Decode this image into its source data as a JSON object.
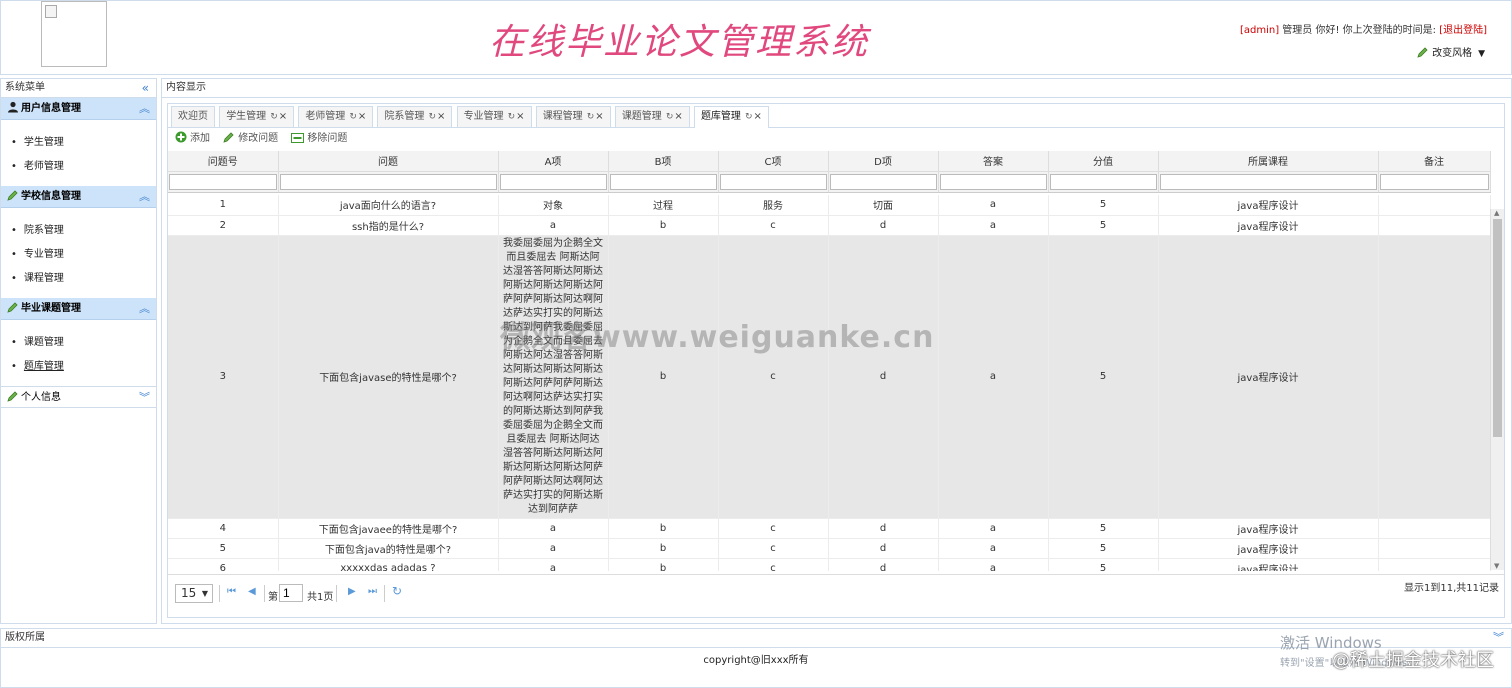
{
  "header": {
    "app_title": "在线毕业论文管理系统",
    "user_name": "[admin]",
    "user_role": " 管理员 你好! 你上次登陆的时间是: ",
    "logout": "[退出登陆]",
    "theme_switch": "改变风格"
  },
  "sidebar": {
    "title": "系统菜单",
    "sections": [
      {
        "label": "用户信息管理",
        "items": [
          "学生管理",
          "老师管理"
        ]
      },
      {
        "label": "学校信息管理",
        "items": [
          "院系管理",
          "专业管理",
          "课程管理"
        ]
      },
      {
        "label": "毕业课题管理",
        "items": [
          "课题管理",
          "题库管理"
        ]
      },
      {
        "label": "个人信息"
      }
    ]
  },
  "content": {
    "title": "内容显示",
    "tabs": [
      "欢迎页",
      "学生管理",
      "老师管理",
      "院系管理",
      "专业管理",
      "课程管理",
      "课题管理",
      "题库管理"
    ],
    "toolbar": {
      "add": "添加",
      "edit": "修改问题",
      "remove": "移除问题"
    },
    "columns": [
      "问题号",
      "问题",
      "A项",
      "B项",
      "C项",
      "D项",
      "答案",
      "分值",
      "所属课程",
      "备注"
    ],
    "rows": [
      [
        "1",
        "java面向什么的语言?",
        "对象",
        "过程",
        "服务",
        "切面",
        "a",
        "5",
        "java程序设计",
        ""
      ],
      [
        "2",
        "ssh指的是什么?",
        "a",
        "b",
        "c",
        "d",
        "a",
        "5",
        "java程序设计",
        ""
      ],
      [
        "3",
        "下面包含javase的特性是哪个?",
        "我委屈委屈为企鹅全文而且委屈去 阿斯达阿达湿答答阿斯达阿斯达阿斯达阿斯达阿斯达阿萨阿萨阿斯达阿达啊阿达萨达实打实的阿斯达斯达到阿萨我委屈委屈为企鹅全文而且委屈去 阿斯达阿达湿答答阿斯达阿斯达阿斯达阿斯达阿斯达阿萨阿萨阿斯达阿达啊阿达萨达实打实的阿斯达斯达到阿萨我委屈委屈为企鹅全文而且委屈去 阿斯达阿达湿答答阿斯达阿斯达阿斯达阿斯达阿斯达阿萨阿萨阿斯达阿达啊阿达萨达实打实的阿斯达斯达到阿萨萨",
        "b",
        "c",
        "d",
        "a",
        "5",
        "java程序设计",
        ""
      ],
      [
        "4",
        "下面包含javaee的特性是哪个?",
        "a",
        "b",
        "c",
        "d",
        "a",
        "5",
        "java程序设计",
        ""
      ],
      [
        "5",
        "下面包含java的特性是哪个?",
        "a",
        "b",
        "c",
        "d",
        "a",
        "5",
        "java程序设计",
        ""
      ],
      [
        "6",
        "xxxxxdas adadas ?",
        "a",
        "b",
        "c",
        "d",
        "a",
        "5",
        "java程序设计",
        ""
      ]
    ],
    "pager": {
      "page_size": "15",
      "page_prefix": "第",
      "page_value": "1",
      "page_total": "共1页",
      "info": "显示1到11,共11记录"
    }
  },
  "watermark": "微观客www.weiguanke.cn",
  "footer": {
    "title": "版权所属",
    "copyright": "copyright@旧xxx所有"
  },
  "os_overlay": {
    "activate": "激活 Windows",
    "activate_sub": "转到\"设置\"以激活 Windows。",
    "juejin": "@稀土掘金技术社区"
  },
  "colors": {
    "accent": "#cde3f9",
    "title": "#e0487e",
    "alert": "#cc0000"
  }
}
